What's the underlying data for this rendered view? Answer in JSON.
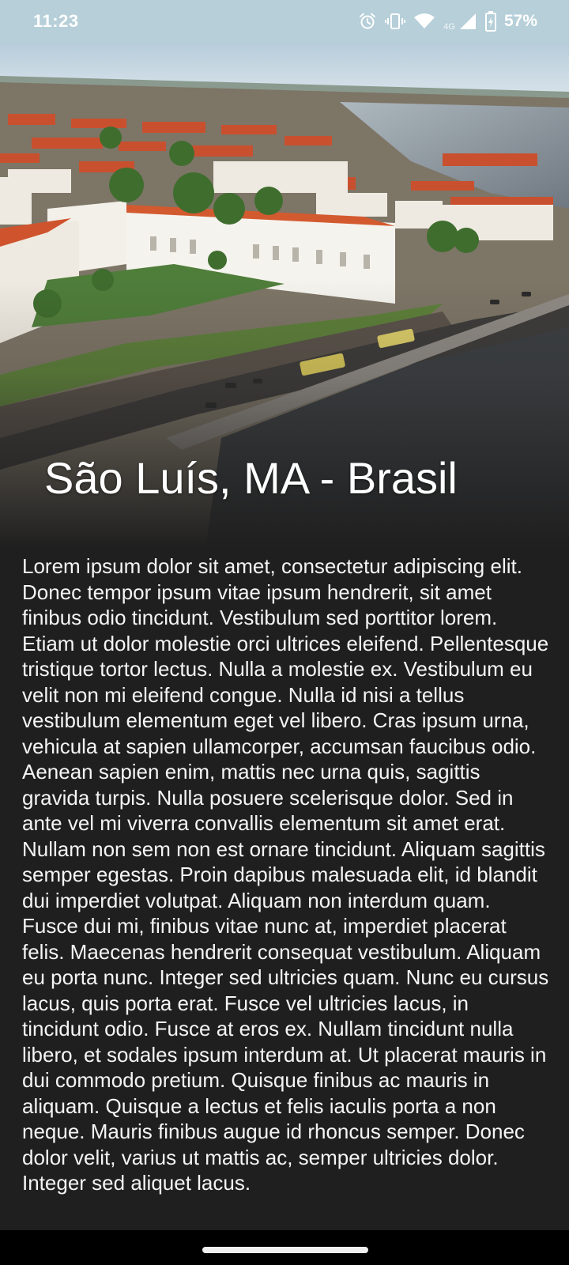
{
  "status_bar": {
    "time": "11:23",
    "network_type": "4G",
    "battery_percent": "57%",
    "icons": [
      "alarm-icon",
      "vibrate-icon",
      "wifi-icon",
      "cell-signal-icon",
      "battery-charging-icon"
    ]
  },
  "hero": {
    "title": "São Luís, MA - Brasil"
  },
  "article": {
    "body": "Lorem ipsum dolor sit amet, consectetur adipiscing elit. Donec tempor ipsum vitae ipsum hendrerit, sit amet finibus odio tincidunt. Vestibulum sed porttitor lorem. Etiam ut dolor molestie orci ultrices eleifend. Pellentesque tristique tortor lectus. Nulla a molestie ex. Vestibulum eu velit non mi eleifend congue. Nulla id nisi a tellus vestibulum elementum eget vel libero. Cras ipsum urna, vehicula at sapien ullamcorper, accumsan faucibus odio. Aenean sapien enim, mattis nec urna quis, sagittis gravida turpis. Nulla posuere scelerisque dolor. Sed in ante vel mi viverra convallis elementum sit amet erat. Nullam non sem non est ornare tincidunt. Aliquam sagittis semper egestas. Proin dapibus malesuada elit, id blandit dui imperdiet volutpat. Aliquam non interdum quam. Fusce dui mi, finibus vitae nunc at, imperdiet placerat felis. Maecenas hendrerit consequat vestibulum. Aliquam eu porta nunc. Integer sed ultricies quam. Nunc eu cursus lacus, quis porta erat. Fusce vel ultricies lacus, in tincidunt odio. Fusce at eros ex. Nullam tincidunt nulla libero, et sodales ipsum interdum at. Ut placerat mauris in dui commodo pretium. Quisque finibus ac mauris in aliquam. Quisque a lectus et felis iaculis porta a non neque. Mauris finibus augue id rhoncus semper. Donec dolor velit, varius ut mattis ac, semper ultricies dolor. Integer sed aliquet lacus."
  },
  "colors": {
    "background": "#1f1f1f",
    "status_bar": "#b6cfd9",
    "text": "#f5f5f5"
  }
}
